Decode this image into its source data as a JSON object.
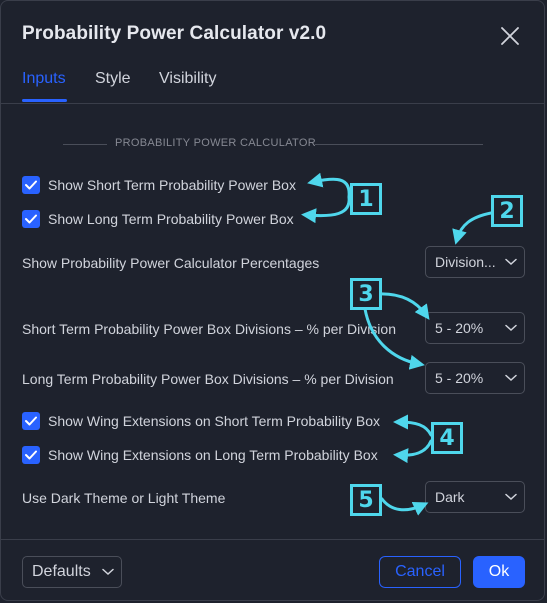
{
  "dialog": {
    "title": "Probability Power Calculator v2.0",
    "close_icon": "close-icon"
  },
  "tabs": [
    {
      "label": "Inputs",
      "active": true
    },
    {
      "label": "Style",
      "active": false
    },
    {
      "label": "Visibility",
      "active": false
    }
  ],
  "section": {
    "heading": "PROBABILITY POWER CALCULATOR"
  },
  "inputs": {
    "show_short_box": {
      "label": "Show Short Term Probability Power Box",
      "checked": true
    },
    "show_long_box": {
      "label": "Show Long Term Probability Power Box",
      "checked": true
    },
    "percentages": {
      "label": "Show Probability Power Calculator Percentages",
      "value": "Division..."
    },
    "short_divisions": {
      "label": "Short Term Probability Power Box Divisions – % per Division",
      "value": "5 - 20%"
    },
    "long_divisions": {
      "label": "Long Term Probability Power Box Divisions – % per Division",
      "value": "5 - 20%"
    },
    "wing_short": {
      "label": "Show Wing Extensions on Short Term Probability Box",
      "checked": true
    },
    "wing_long": {
      "label": "Show Wing Extensions on Long Term Probability Box",
      "checked": true
    },
    "theme": {
      "label": "Use Dark Theme or Light Theme",
      "value": "Dark"
    }
  },
  "footer": {
    "defaults_label": "Defaults",
    "cancel_label": "Cancel",
    "ok_label": "Ok"
  },
  "callouts": [
    "1",
    "2",
    "3",
    "4",
    "5"
  ],
  "colors": {
    "background": "#1e222d",
    "accent": "#2962ff",
    "annotation": "#4fd7ec",
    "text": "#d1d4dc",
    "border": "#4a4e59"
  }
}
